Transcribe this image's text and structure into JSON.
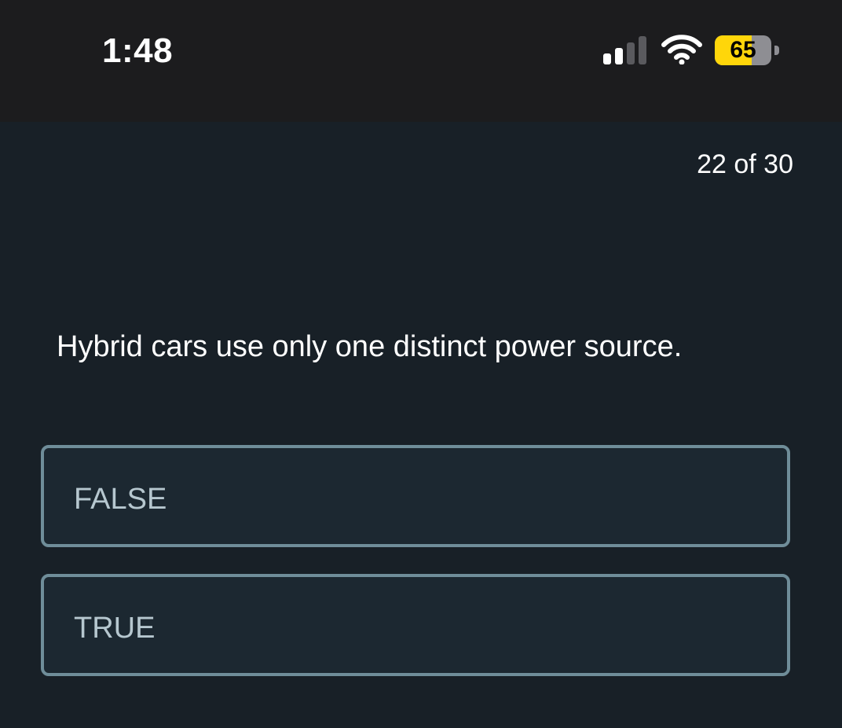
{
  "status_bar": {
    "time": "1:48",
    "battery_level": "65",
    "battery_percent": 65,
    "signal_bars_active": 2,
    "signal_bars_total": 4,
    "icons": [
      "cellular-signal-icon",
      "wifi-icon",
      "battery-icon"
    ],
    "battery_color": "#ffd60a"
  },
  "quiz": {
    "progress": "22 of 30",
    "question": "Hybrid cars use only one distinct power source.",
    "options": [
      {
        "label": "FALSE"
      },
      {
        "label": "TRUE"
      }
    ]
  },
  "colors": {
    "background": "#182027",
    "status_bar_background": "#1c1c1e",
    "option_border": "#6f8d99",
    "option_background": "#1c2831",
    "option_text": "#b6c7cf"
  }
}
